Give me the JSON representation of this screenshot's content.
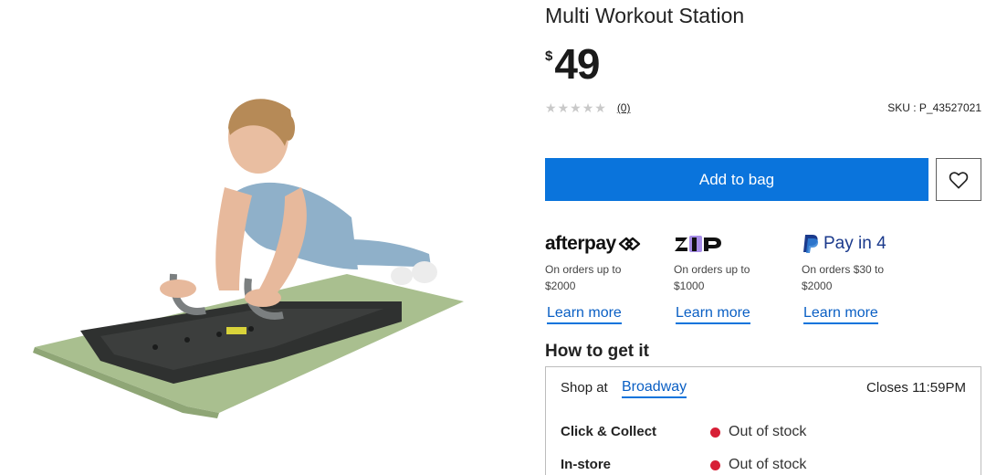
{
  "product": {
    "title": "Multi Workout Station",
    "currency_symbol": "$",
    "price": "49",
    "rating": {
      "stars_filled": 0,
      "stars_total": 5,
      "review_count": "(0)"
    },
    "sku": "SKU : P_43527021",
    "image_icon": "product-photo-woman-plank-workout-station"
  },
  "actions": {
    "add_to_bag_label": "Add to bag",
    "wishlist_icon": "heart-icon"
  },
  "payment_options": [
    {
      "name": "afterpay",
      "logo_text": "afterpay",
      "note": "On orders up to $2000",
      "link": "Learn more"
    },
    {
      "name": "zip",
      "logo_text": "zip",
      "note": "On orders up to $1000",
      "link": "Learn more"
    },
    {
      "name": "paypal",
      "logo_text": "Pay in 4",
      "note": "On orders $30 to $2000",
      "link": "Learn more"
    }
  ],
  "fulfilment": {
    "heading": "How to get it",
    "shop_at_label": "Shop at",
    "store_name": "Broadway",
    "closes": "Closes 11:59PM",
    "options": [
      {
        "label": "Click & Collect",
        "status": "Out of stock"
      },
      {
        "label": "In-store",
        "status": "Out of stock"
      }
    ]
  },
  "colors": {
    "primary_button": "#0a74dc",
    "link": "#0a5fc4",
    "out_of_stock": "#d71f36",
    "star_empty": "#c9c9c9",
    "mat_green": "#a9bf8f"
  }
}
